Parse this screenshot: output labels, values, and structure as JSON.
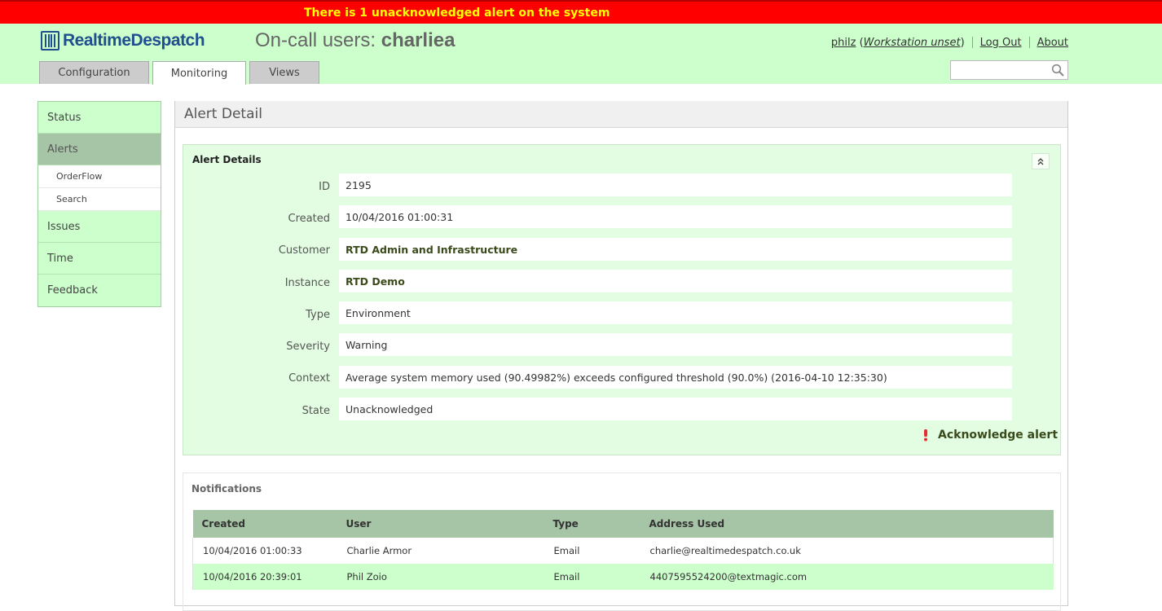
{
  "banner": {
    "text": "There is 1 unacknowledged alert on the system"
  },
  "header": {
    "brand": "RealtimeDespatch",
    "title_prefix": "On-call users: ",
    "title_user": "charliea",
    "user": "philz",
    "workstation": "Workstation unset",
    "logout": "Log Out",
    "about": "About"
  },
  "search": {
    "placeholder": ""
  },
  "tabs": [
    {
      "label": "Configuration"
    },
    {
      "label": "Monitoring"
    },
    {
      "label": "Views"
    }
  ],
  "sidebar": {
    "items": [
      {
        "label": "Status"
      },
      {
        "label": "Alerts"
      },
      {
        "label": "OrderFlow"
      },
      {
        "label": "Search"
      },
      {
        "label": "Issues"
      },
      {
        "label": "Time"
      },
      {
        "label": "Feedback"
      }
    ]
  },
  "main": {
    "title": "Alert Detail",
    "details_title": "Alert Details",
    "fields": [
      {
        "label": "ID",
        "value": "2195"
      },
      {
        "label": "Created",
        "value": "10/04/2016 01:00:31"
      },
      {
        "label": "Customer",
        "value": "RTD Admin and Infrastructure"
      },
      {
        "label": "Instance",
        "value": "RTD Demo"
      },
      {
        "label": "Type",
        "value": "Environment"
      },
      {
        "label": "Severity",
        "value": "Warning"
      },
      {
        "label": "Context",
        "value": "Average system memory used (90.49982%) exceeds configured threshold (90.0%) (2016-04-10 12:35:30)"
      },
      {
        "label": "State",
        "value": "Unacknowledged"
      }
    ],
    "acknowledge_label": "Acknowledge alert"
  },
  "notifications": {
    "title": "Notifications",
    "columns": [
      "Created",
      "User",
      "Type",
      "Address Used"
    ],
    "rows": [
      [
        "10/04/2016 01:00:33",
        "Charlie Armor",
        "Email",
        "charlie@realtimedespatch.co.uk"
      ],
      [
        "10/04/2016 20:39:01",
        "Phil Zoio",
        "Email",
        "4407595524200@textmagic.com"
      ]
    ]
  },
  "colors": {
    "banner_bg": "#ff0000",
    "banner_text": "#ffff00",
    "header_bg": "#ccffcc",
    "accent_green": "#a6c4a6",
    "brand_blue": "#1f4f8f"
  }
}
